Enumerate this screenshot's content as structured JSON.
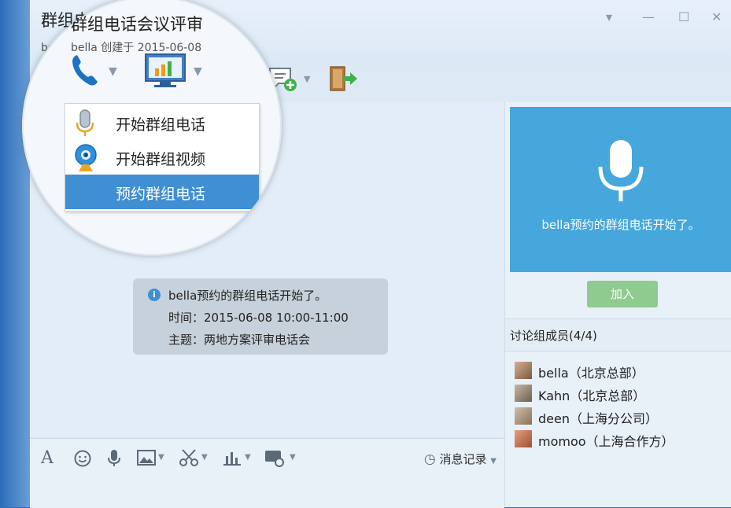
{
  "window": {
    "title": "群组电话会议评审",
    "subtitle": "bella 创建于 2015-06-08",
    "controls": [
      "▾",
      "—",
      "☐",
      "✕"
    ]
  },
  "toolbar": {
    "items": [
      "phone-icon",
      "screen-share-icon",
      "mail-icon",
      "add-message-icon",
      "exit-icon"
    ]
  },
  "dropdown_menu": {
    "items": [
      {
        "icon": "microphone-icon",
        "label": "开始群组电话"
      },
      {
        "icon": "webcam-icon",
        "label": "开始群组视频"
      },
      {
        "icon": "",
        "label": "预约群组电话",
        "selected": true
      }
    ]
  },
  "system_message": {
    "line1": "bella预约的群组电话开始了。",
    "line2": "时间：2015-06-08 10:00-11:00",
    "line3": "主题：两地方案评审电话会"
  },
  "input_toolbar": {
    "items": [
      "font-icon",
      "emoji-icon",
      "voice-icon",
      "image-icon",
      "scissors-icon",
      "chart-icon",
      "screenshot-icon"
    ],
    "history_label": "消息记录"
  },
  "right_panel": {
    "call_text": "bella预约的群组电话开始了。",
    "join_label": "加入",
    "members_header": "讨论组成员(4/4)",
    "members": [
      {
        "name": "bella（北京总部）"
      },
      {
        "name": "Kahn（北京总部）"
      },
      {
        "name": "deen（上海分公司）"
      },
      {
        "name": "momoo（上海合作方）"
      }
    ]
  },
  "colors": {
    "accent_blue": "#3f8fd2",
    "call_card": "#45a7dc",
    "join_button": "#8fcb8f"
  }
}
